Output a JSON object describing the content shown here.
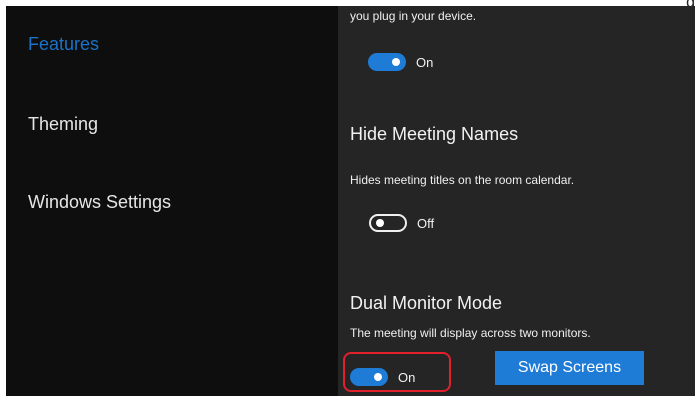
{
  "sidebar": {
    "items": [
      {
        "label": "Features",
        "active": true
      },
      {
        "label": "Theming",
        "active": false
      },
      {
        "label": "Windows Settings",
        "active": false
      }
    ]
  },
  "settings": {
    "plug_in_desc": "you plug in your device.",
    "plug_in_toggle": {
      "state": "on",
      "label": "On"
    },
    "hide_meeting_names": {
      "title": "Hide Meeting Names",
      "description": "Hides meeting titles on the room calendar.",
      "toggle": {
        "state": "off",
        "label": "Off"
      }
    },
    "dual_monitor": {
      "title": "Dual Monitor Mode",
      "description": "The meeting will display across two monitors.",
      "toggle": {
        "state": "on",
        "label": "On"
      },
      "swap_button_label": "Swap Screens"
    }
  },
  "colors": {
    "accent": "#1e7bd6",
    "highlight_border": "#e0202a",
    "sidebar_bg": "#0e0e0e",
    "content_bg": "#252525"
  },
  "top_edge_char": "g"
}
